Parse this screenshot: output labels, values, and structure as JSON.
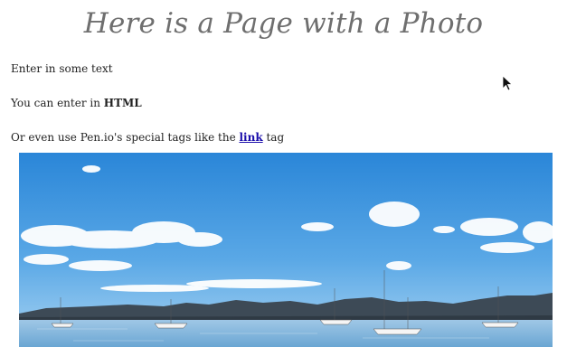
{
  "page": {
    "title": "Here is a Page with a Photo",
    "line1": "Enter in some text",
    "line2_prefix": "You can enter in ",
    "line2_bold": "HTML",
    "line3_prefix": "Or even use Pen.io's special tags like the ",
    "line3_link": "link",
    "line3_suffix": " tag"
  },
  "colors": {
    "title": "#6f6f6f",
    "text": "#222222",
    "link": "#1a0dab",
    "sky_top": "#2a86d8",
    "sky_bottom": "#a9d4f2",
    "water": "#7fb6dc",
    "hills": "#3d4a56"
  },
  "icons": {
    "cursor": "mouse-pointer-icon"
  }
}
